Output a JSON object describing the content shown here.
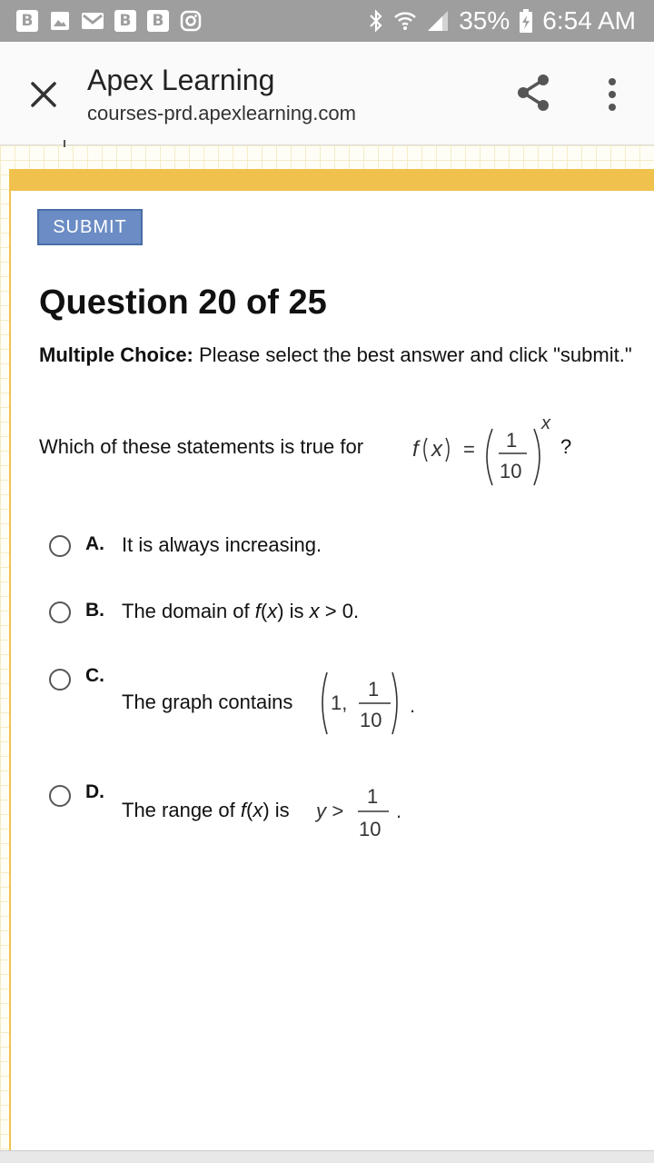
{
  "status_bar": {
    "notification_icons": [
      "B",
      "image-icon",
      "gmail-icon",
      "B",
      "B",
      "instagram-icon"
    ],
    "battery": "35%",
    "time": "6:54 AM"
  },
  "app_bar": {
    "title": "Apex Learning",
    "url": "courses-prd.apexlearning.com"
  },
  "submit_label": "SUBMIT",
  "question": {
    "title": "Question 20 of 25",
    "instruction_label": "Multiple Choice:",
    "instruction_text": " Please select the best answer and click \"submit.\"",
    "prompt": "Which of these statements is true for",
    "prompt_end": "?",
    "formula": {
      "fn": "f",
      "var": "x",
      "equals": "=",
      "numerator": "1",
      "denominator": "10",
      "exponent": "x"
    }
  },
  "options": [
    {
      "letter": "A.",
      "text": "It is always increasing."
    },
    {
      "letter": "B.",
      "text_pre": "The domain of ",
      "fn": "f",
      "paren_open": "(",
      "var": "x",
      "paren_close": ")",
      "text_mid": " is ",
      "var2": "x",
      "text_post": " > 0."
    },
    {
      "letter": "C.",
      "text": "The graph contains",
      "point_first": "1,",
      "numerator": "1",
      "denominator": "10",
      "period": "."
    },
    {
      "letter": "D.",
      "text_pre": "The range of ",
      "fn": "f",
      "paren_open": "(",
      "var": "x",
      "paren_close": ")",
      "text_mid": " is",
      "ineq": "y >",
      "numerator": "1",
      "denominator": "10",
      "period": "."
    }
  ],
  "colors": {
    "accent_yellow": "#f0c24d",
    "submit_blue": "#6b8cc4",
    "status_gray": "#9e9e9e"
  }
}
